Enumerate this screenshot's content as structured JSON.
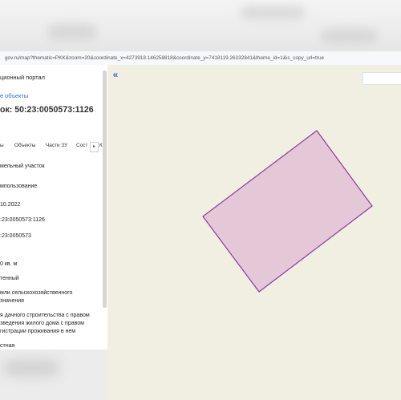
{
  "browser": {
    "address": "gov.ru/map?thematic=PKK&zoom=20&coordinate_x=4273918.146258818&coordinate_y=7418119.26332841&theme_id=1&is_copy_url=true"
  },
  "panel": {
    "portal_title": "ционный портал",
    "objects_link": "е объекты",
    "parcel_title": "ок: 50:23:0050573:1126",
    "tabs": [
      "ы",
      "Объекты",
      "Части ЗУ",
      "Сост"
    ],
    "tab_more": "К",
    "tab_arrow": "▸",
    "fields": [
      "мельный участок",
      "мпользование",
      "10.2022",
      ":23:0050573:1126",
      ":23:0050573",
      "0 кв. м",
      "тенный",
      "мли сельскохозяйственного",
      "значения",
      "я дачного строительства с правом",
      "зведения жилого дома с правом",
      "гистрации проживания в нем",
      "стная"
    ]
  },
  "map": {
    "collapse_icon_text": "«",
    "parcel_fill": "#e5c8d8",
    "parcel_stroke": "#8b3aa0"
  }
}
